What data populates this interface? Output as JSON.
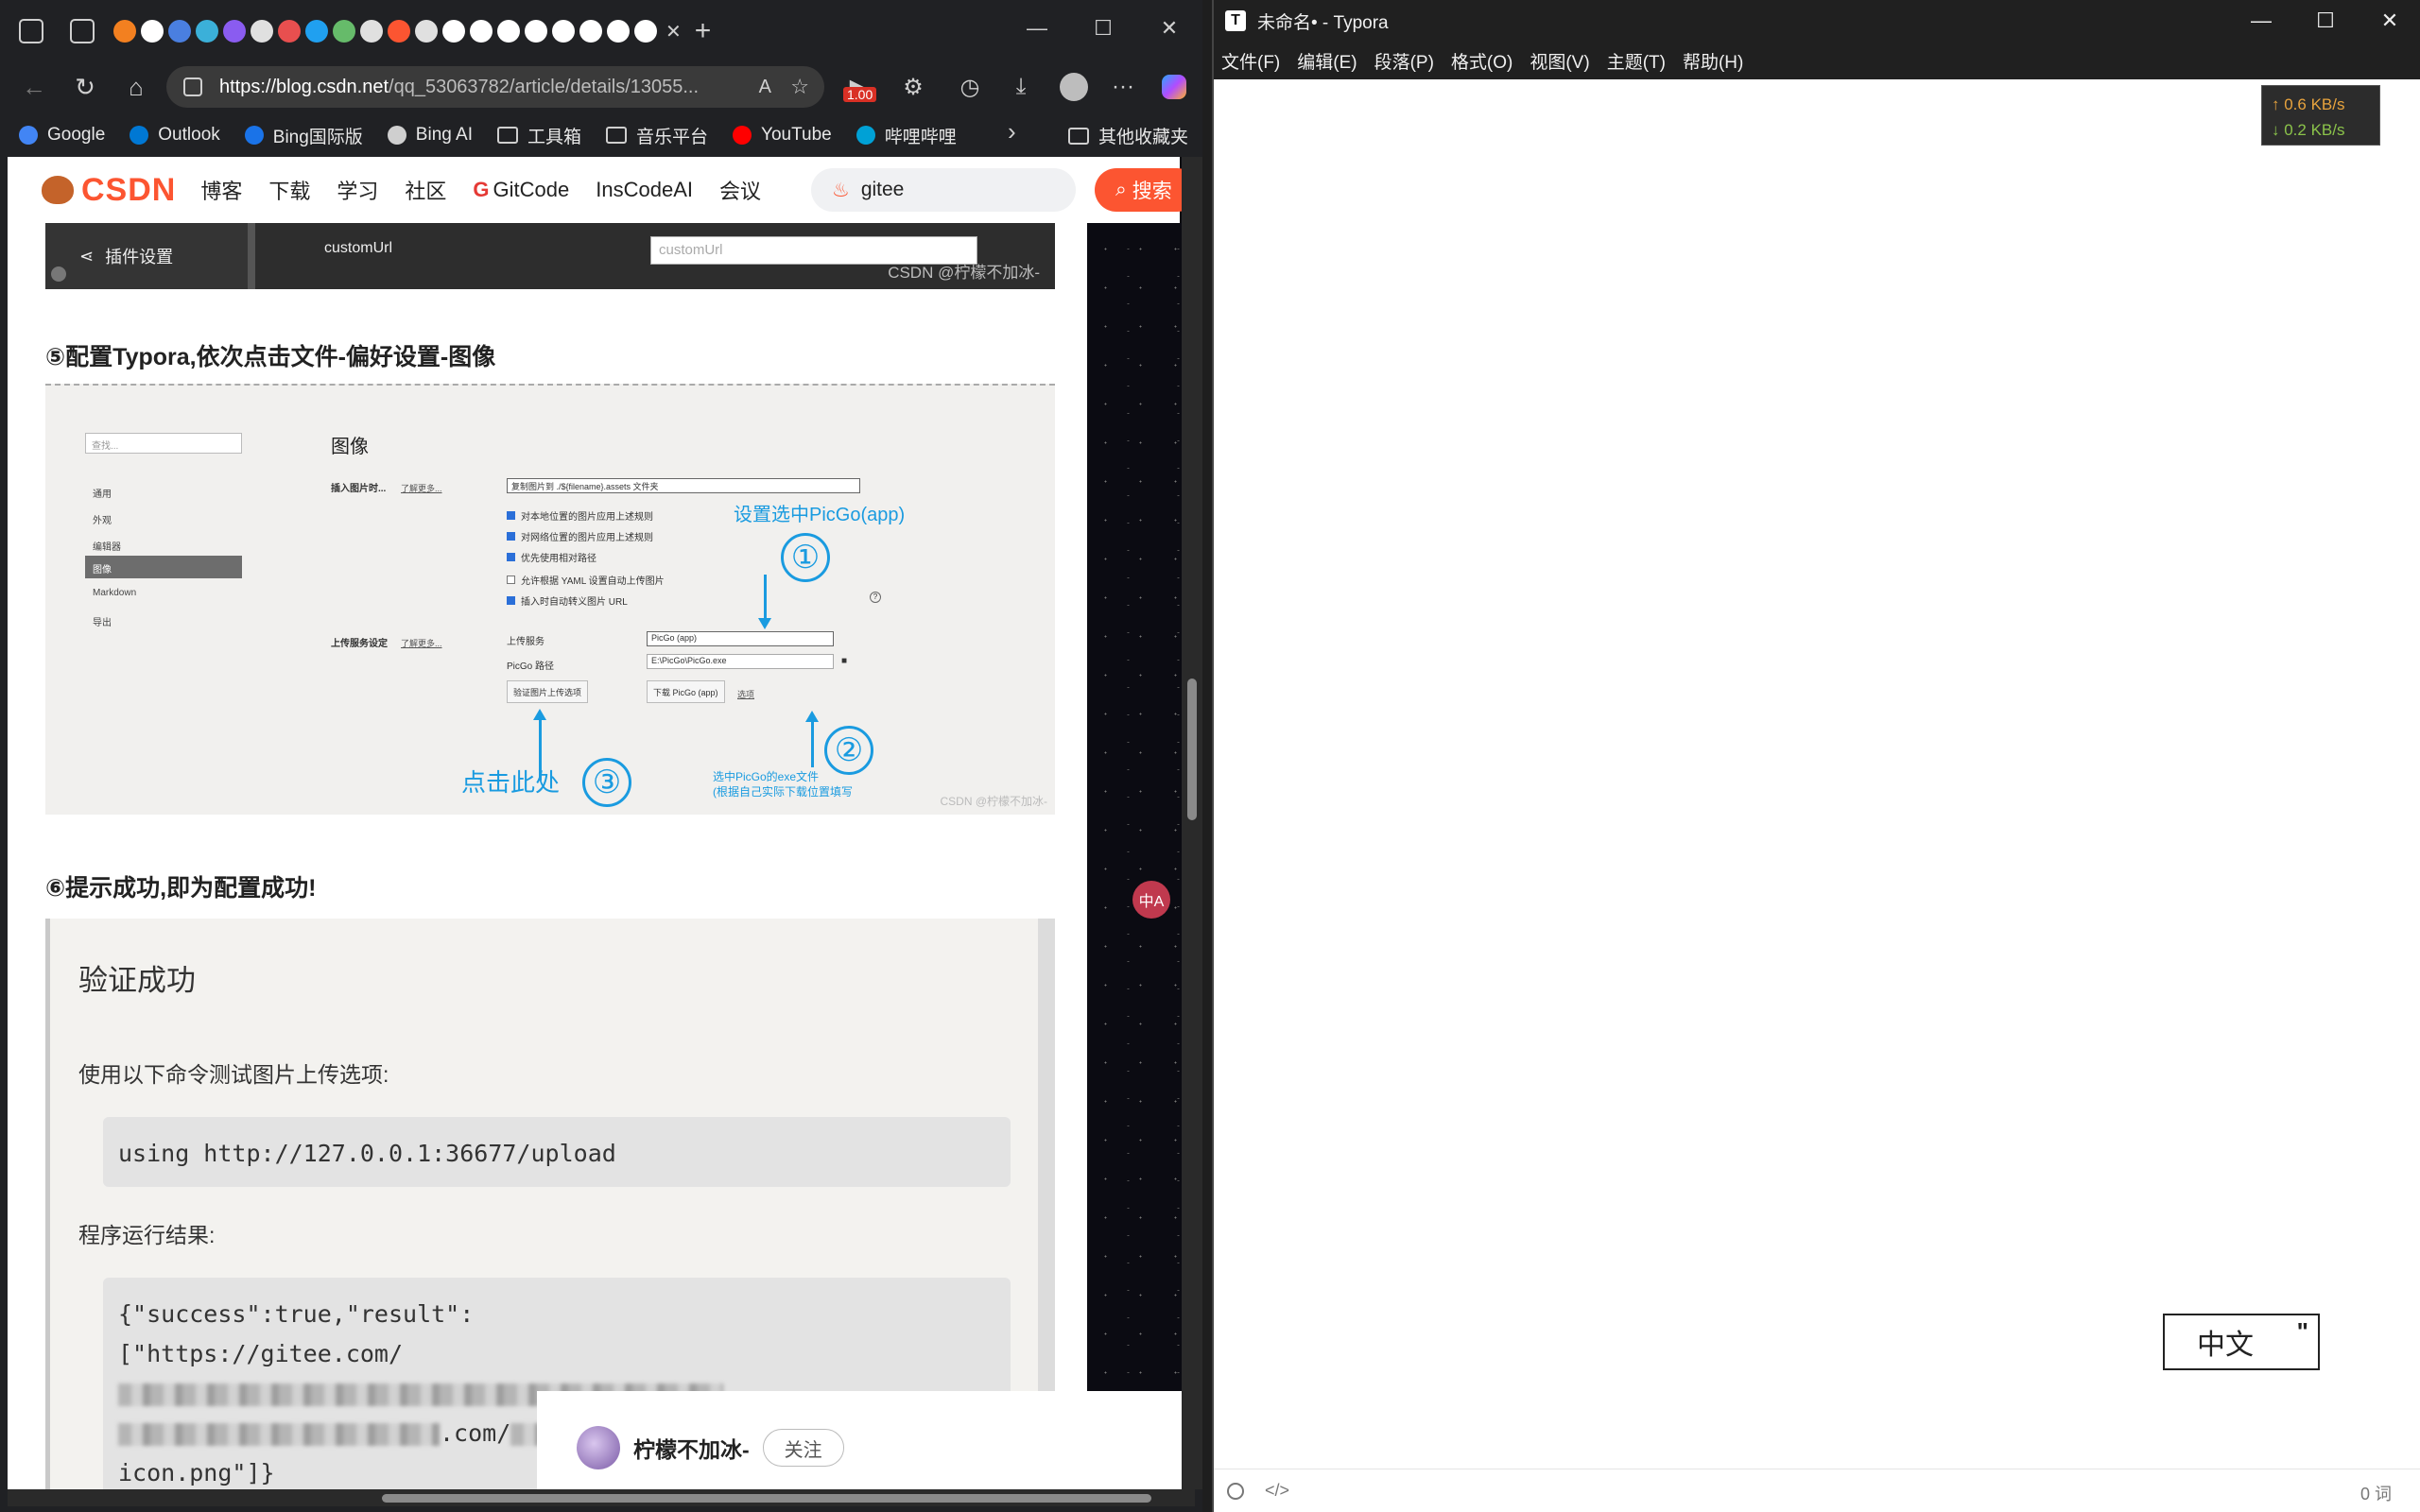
{
  "browser": {
    "tab_colors": [
      "#f38020",
      "#ffffff",
      "#4a7fe0",
      "#3bb0d9",
      "#8a5cf0",
      "#e0e0e0",
      "#e84f4f",
      "#20a0f0",
      "#66bb6a",
      "#e0e0e0",
      "#fc5531",
      "#e0e0e0",
      "#ffffff",
      "#ffffff",
      "#ffffff",
      "#ffffff",
      "#ffffff",
      "#ffffff",
      "#ffffff",
      "#ffffff"
    ],
    "new_tab": "+",
    "controls": {
      "minimize": "—",
      "maximize": "☐",
      "close": "✕"
    },
    "nav": {
      "back": "←",
      "reload": "↻",
      "home": "⌂"
    },
    "url_host": "https://blog.csdn.net",
    "url_rest": "/qq_53063782/article/details/13055...",
    "perf_badge": "1.00",
    "bookmarks": [
      {
        "label": "Google",
        "icon": "google-icon",
        "color": "#4285f4"
      },
      {
        "label": "Outlook",
        "icon": "outlook-icon",
        "color": "#0078d4"
      },
      {
        "label": "Bing国际版",
        "icon": "search-icon",
        "color": "#1a73e8"
      },
      {
        "label": "Bing AI",
        "icon": "search-icon",
        "color": "#cfcfcf"
      },
      {
        "label": "工具箱",
        "icon": "folder-icon",
        "color": "#cfcfcf"
      },
      {
        "label": "音乐平台",
        "icon": "folder-icon",
        "color": "#cfcfcf"
      },
      {
        "label": "YouTube",
        "icon": "youtube-icon",
        "color": "#ff0000"
      },
      {
        "label": "哔哩哔哩",
        "icon": "bilibili-icon",
        "color": "#00a1d6"
      }
    ],
    "bookmarks_more": "›",
    "other_bookmarks": "其他收藏夹"
  },
  "csdn": {
    "logo": "CSDN",
    "nav": [
      "博客",
      "下载",
      "学习",
      "社区",
      "GitCode",
      "InsCodeAI",
      "会议"
    ],
    "search_value": "gitee",
    "search_button": "搜索"
  },
  "article": {
    "img_top": {
      "side_label": "插件设置",
      "field_label": "customUrl",
      "field_placeholder": "customUrl",
      "watermark": "CSDN @柠檬不加冰-"
    },
    "heading_5": "⑤配置Typora,依次点击文件-偏好设置-图像",
    "pref": {
      "search_placeholder": "查找...",
      "menu": [
        "通用",
        "外观",
        "编辑器",
        "图像",
        "Markdown",
        "导出"
      ],
      "selected": "图像",
      "title": "图像",
      "insert_label": "插入图片时...",
      "learn_more": "了解更多...",
      "insert_select": "复制图片到 ./${filename}.assets 文件夹",
      "checks": [
        {
          "label": "对本地位置的图片应用上述规则",
          "checked": true
        },
        {
          "label": "对网络位置的图片应用上述规则",
          "checked": true
        },
        {
          "label": "优先使用相对路径",
          "checked": true
        },
        {
          "label": "允许根据 YAML 设置自动上传图片",
          "checked": false
        },
        {
          "label": "插入时自动转义图片 URL",
          "checked": true
        }
      ],
      "help": "?",
      "upload_label": "上传服务设定",
      "upload_service_label": "上传服务",
      "upload_service": "PicGo (app)",
      "picgo_path_label": "PicGo 路径",
      "picgo_path": "E:\\PicGo\\PicGo.exe",
      "verify_button": "验证图片上传选项",
      "download_button": "下载 PicGo (app)",
      "option_link": "选项",
      "anno_1": "设置选中PicGo(app)",
      "anno_2": "选中PicGo的exe文件\n(根据自己实际下载位置填写",
      "anno_3": "点击此处",
      "circle_1": "①",
      "circle_2": "②",
      "circle_3": "③",
      "watermark": "CSDN @柠檬不加冰-"
    },
    "heading_6": "⑥提示成功,即为配置成功!",
    "ok": {
      "title": "验证成功",
      "subtitle": "使用以下命令测试图片上传选项:",
      "command": "using http://127.0.0.1:36677/upload",
      "result_label": "程序运行结果:",
      "result_line1": "{\"success\":true,\"result\":",
      "result_line2": "[\"https://gitee.com/",
      "result_line3b": ".com/",
      "result_line4": "icon.png\"]}"
    },
    "author": {
      "name": "柠檬不加冰-",
      "follow": "关注"
    },
    "translate_badge": "中A"
  },
  "typora": {
    "title": "未命名• - Typora",
    "logo": "T",
    "menus": [
      "文件(F)",
      "编辑(E)",
      "段落(P)",
      "格式(O)",
      "视图(V)",
      "主题(T)",
      "帮助(H)"
    ],
    "net_up": "↑ 0.6 KB/s",
    "net_down": "↓ 0.2 KB/s",
    "ime": "中文",
    "ime_quote": "\"",
    "source_toggle": "</>",
    "word_count": "0 词"
  }
}
